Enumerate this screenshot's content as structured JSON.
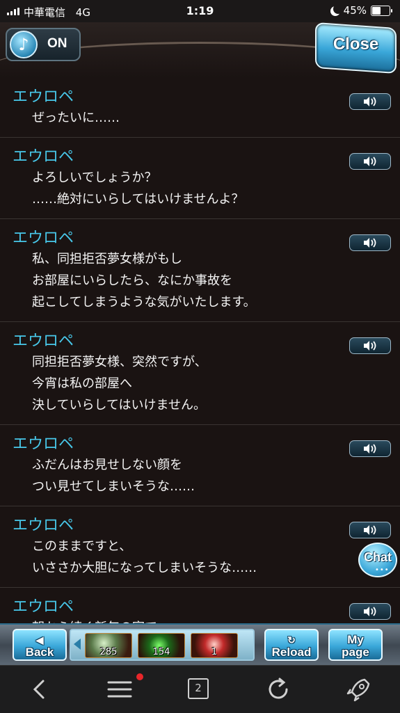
{
  "status_bar": {
    "carrier": "中華電信",
    "network": "4G",
    "time": "1:19",
    "battery": "45%",
    "battery_level": 0.45
  },
  "header": {
    "music_label": "ON",
    "close_label": "Close"
  },
  "log": [
    {
      "speaker": "エウロペ",
      "lines": [
        "ぜったいに……"
      ]
    },
    {
      "speaker": "エウロペ",
      "lines": [
        "よろしいでしょうか？",
        "……絶対にいらしてはいけませんよ？"
      ]
    },
    {
      "speaker": "エウロペ",
      "lines": [
        "私、同担拒否夢女様がもし",
        "お部屋にいらしたら、なにか事故を",
        "起こしてしまうような気がいたします。"
      ]
    },
    {
      "speaker": "エウロペ",
      "lines": [
        "同担拒否夢女様、突然ですが、",
        "今宵は私の部屋へ",
        "決していらしてはいけません。"
      ]
    },
    {
      "speaker": "エウロペ",
      "lines": [
        "ふだんはお見せしない顔を",
        "つい見せてしまいそうな……"
      ]
    },
    {
      "speaker": "エウロペ",
      "lines": [
        "このままですと、",
        "いささか大胆になってしまいそうな……"
      ]
    },
    {
      "speaker": "エウロペ",
      "lines": [
        "朝から続く新年の宴で"
      ]
    }
  ],
  "chat_label": "Chat",
  "game_nav": {
    "back_top": "◀",
    "back_label": "Back",
    "reload_top": "↻",
    "reload_label": "Reload",
    "mypage_top": "My",
    "mypage_label": "page",
    "items": [
      {
        "count": "285"
      },
      {
        "count": "154"
      },
      {
        "count": "1"
      }
    ]
  },
  "browser_toolbar": {
    "tab_count": "2"
  },
  "icons": {
    "music": "music-note-icon",
    "voice": "speaker-icon",
    "back": "chevron-left-icon",
    "menu": "hamburger-menu-icon",
    "tabs": "tabs-icon",
    "refresh": "refresh-icon",
    "rocket": "rocket-icon"
  },
  "colors": {
    "speaker_name": "#48c8ea",
    "background": "#1a1312",
    "accent": "#3aa7d9",
    "notification": "#e8262a"
  }
}
